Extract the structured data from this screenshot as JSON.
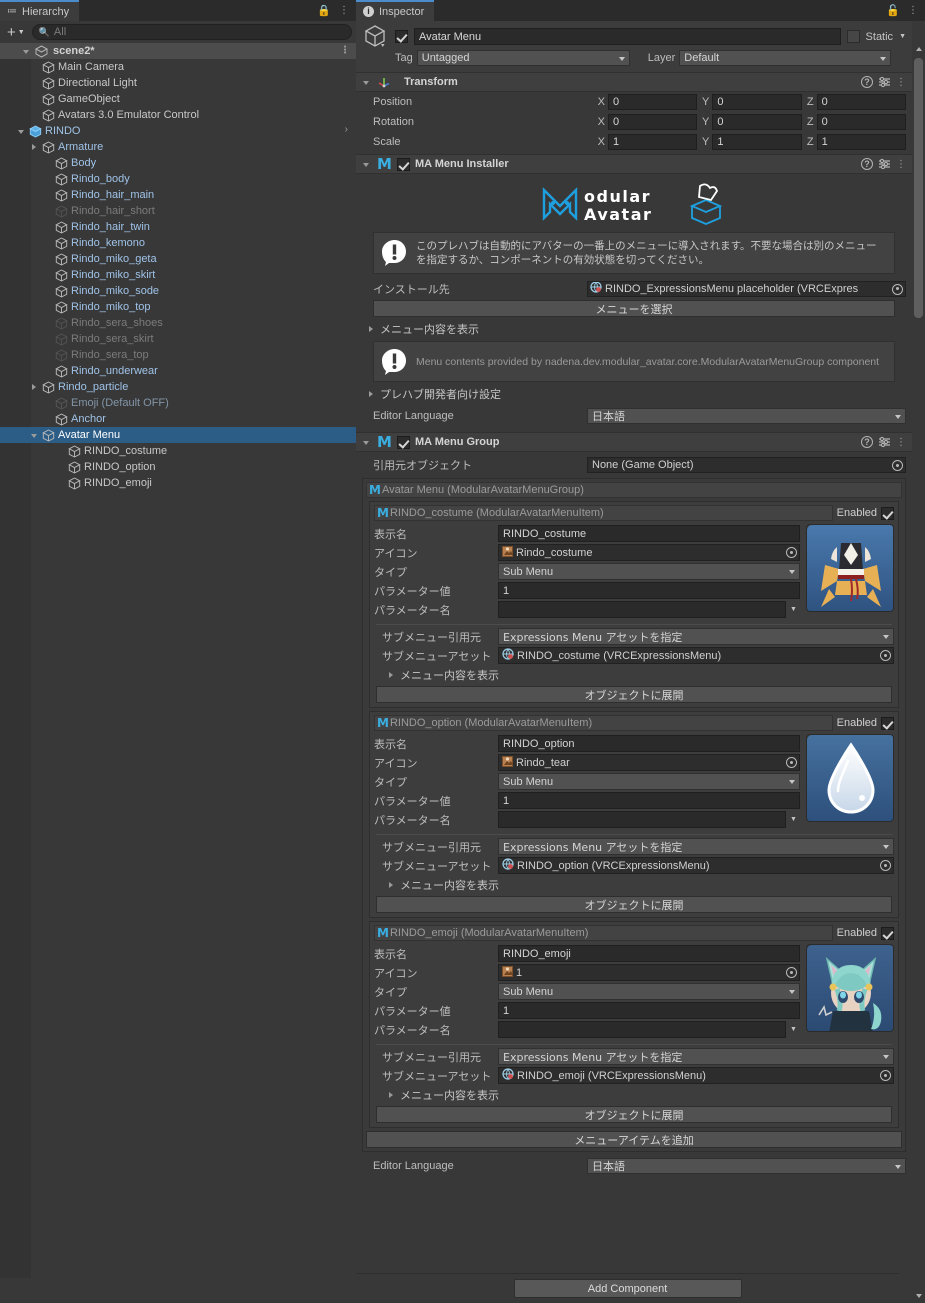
{
  "hierarchy": {
    "tab_label": "Hierarchy",
    "tab_icon": "list-icon",
    "lock_icon": "lock-icon",
    "menu_icon": "kebab-menu-icon",
    "create_label": "+",
    "search_placeholder": "All",
    "scene_name": "scene2*",
    "items": [
      {
        "label": "Main Camera",
        "indent": 2,
        "arrow": "none",
        "style": "white"
      },
      {
        "label": "Directional Light",
        "indent": 2,
        "arrow": "none",
        "style": "white"
      },
      {
        "label": "GameObject",
        "indent": 2,
        "arrow": "none",
        "style": "white"
      },
      {
        "label": "Avatars 3.0 Emulator Control",
        "indent": 2,
        "arrow": "none",
        "style": "white"
      },
      {
        "label": "RINDO",
        "indent": 1,
        "arrow": "down",
        "style": "prefab",
        "chevron_right": true
      },
      {
        "label": "Armature",
        "indent": 2,
        "arrow": "right",
        "style": "prefab"
      },
      {
        "label": "Body",
        "indent": 3,
        "arrow": "none",
        "style": "prefab"
      },
      {
        "label": "Rindo_body",
        "indent": 3,
        "arrow": "none",
        "style": "prefab"
      },
      {
        "label": "Rindo_hair_main",
        "indent": 3,
        "arrow": "none",
        "style": "prefab"
      },
      {
        "label": "Rindo_hair_short",
        "indent": 3,
        "arrow": "none",
        "style": "disabled"
      },
      {
        "label": "Rindo_hair_twin",
        "indent": 3,
        "arrow": "none",
        "style": "prefab"
      },
      {
        "label": "Rindo_kemono",
        "indent": 3,
        "arrow": "none",
        "style": "prefab"
      },
      {
        "label": "Rindo_miko_geta",
        "indent": 3,
        "arrow": "none",
        "style": "prefab"
      },
      {
        "label": "Rindo_miko_skirt",
        "indent": 3,
        "arrow": "none",
        "style": "prefab"
      },
      {
        "label": "Rindo_miko_sode",
        "indent": 3,
        "arrow": "none",
        "style": "prefab"
      },
      {
        "label": "Rindo_miko_top",
        "indent": 3,
        "arrow": "none",
        "style": "prefab"
      },
      {
        "label": "Rindo_sera_shoes",
        "indent": 3,
        "arrow": "none",
        "style": "disabled"
      },
      {
        "label": "Rindo_sera_skirt",
        "indent": 3,
        "arrow": "none",
        "style": "disabled"
      },
      {
        "label": "Rindo_sera_top",
        "indent": 3,
        "arrow": "none",
        "style": "disabled"
      },
      {
        "label": "Rindo_underwear",
        "indent": 3,
        "arrow": "none",
        "style": "prefab"
      },
      {
        "label": "Rindo_particle",
        "indent": 2,
        "arrow": "right",
        "style": "prefab"
      },
      {
        "label": "Emoji (Default OFF)",
        "indent": 3,
        "arrow": "none",
        "style": "disabled2"
      },
      {
        "label": "Anchor",
        "indent": 3,
        "arrow": "none",
        "style": "prefab"
      },
      {
        "label": "Avatar Menu",
        "indent": 2,
        "arrow": "down",
        "style": "selected"
      },
      {
        "label": "RINDO_costume",
        "indent": 4,
        "arrow": "none",
        "style": "white"
      },
      {
        "label": "RINDO_option",
        "indent": 4,
        "arrow": "none",
        "style": "white"
      },
      {
        "label": "RINDO_emoji",
        "indent": 4,
        "arrow": "none",
        "style": "white"
      }
    ]
  },
  "inspector": {
    "tab_label": "Inspector",
    "tab_icon": "info-icon",
    "lock_icon": "lock-icon",
    "menu_icon": "kebab-menu-icon",
    "game_object": {
      "icon": "gameobject-cube-icon",
      "enabled": true,
      "name": "Avatar Menu",
      "static_label": "Static",
      "static_checked": false,
      "tag_label": "Tag",
      "tag_value": "Untagged",
      "layer_label": "Layer",
      "layer_value": "Default"
    },
    "transform": {
      "title": "Transform",
      "icon": "transform-axis-icon",
      "help_icon": "help-icon",
      "preset_icon": "preset-icon",
      "menu_icon": "kebab-menu-icon",
      "rows": [
        {
          "label": "Position",
          "x": "0",
          "y": "0",
          "z": "0"
        },
        {
          "label": "Rotation",
          "x": "0",
          "y": "0",
          "z": "0"
        },
        {
          "label": "Scale",
          "x": "1",
          "y": "1",
          "z": "1"
        }
      ],
      "axis_labels": [
        "X",
        "Y",
        "Z"
      ]
    },
    "menu_installer": {
      "title": "MA Menu Installer",
      "enabled": true,
      "logo_line1": "odular",
      "logo_line2": "Avatar",
      "help_text": "このプレハブは自動的にアバターの一番上のメニューに導入されます。不要な場合は別のメニューを指定するか、コンポーネントの有効状態を切ってください。",
      "install_target_label": "インストール先",
      "install_target_value": "RINDO_ExpressionsMenu placeholder (VRCExpres",
      "select_menu_button": "メニューを選択",
      "show_contents_foldout": "メニュー内容を表示",
      "contents_note": "Menu contents provided by nadena.dev.modular_avatar.core.ModularAvatarMenuGroup component",
      "prefab_dev_foldout": "プレハブ開発者向け設定",
      "editor_language_label": "Editor Language",
      "editor_language_value": "日本語"
    },
    "menu_group": {
      "title": "MA Menu Group",
      "enabled": true,
      "source_object_label": "引用元オブジェクト",
      "source_object_value": "None (Game Object)",
      "group_header": "Avatar Menu (ModularAvatarMenuGroup)",
      "enabled_label": "Enabled",
      "field_labels": {
        "display_name": "表示名",
        "icon": "アイコン",
        "type": "タイプ",
        "param_value": "パラメーター値",
        "param_name": "パラメーター名",
        "submenu_source": "サブメニュー引用元",
        "submenu_asset": "サブメニューアセット",
        "show_contents": "メニュー内容を表示",
        "extract_button": "オブジェクトに展開"
      },
      "items": [
        {
          "header": "RINDO_costume (ModularAvatarMenuItem)",
          "enabled": true,
          "display_name": "RINDO_costume",
          "icon_value": "Rindo_costume",
          "type_value": "Sub Menu",
          "param_value": "1",
          "param_name": "",
          "submenu_source_value": "Expressions Menu アセットを指定",
          "submenu_asset_value": "RINDO_costume (VRCExpressionsMenu)",
          "thumbnail": "costume-thumbnail"
        },
        {
          "header": "RINDO_option (ModularAvatarMenuItem)",
          "enabled": true,
          "display_name": "RINDO_option",
          "icon_value": "Rindo_tear",
          "type_value": "Sub Menu",
          "param_value": "1",
          "param_name": "",
          "submenu_source_value": "Expressions Menu アセットを指定",
          "submenu_asset_value": "RINDO_option (VRCExpressionsMenu)",
          "thumbnail": "teardrop-thumbnail"
        },
        {
          "header": "RINDO_emoji (ModularAvatarMenuItem)",
          "enabled": true,
          "display_name": "RINDO_emoji",
          "icon_value": "1",
          "type_value": "Sub Menu",
          "param_value": "1",
          "param_name": "",
          "submenu_source_value": "Expressions Menu アセットを指定",
          "submenu_asset_value": "RINDO_emoji (VRCExpressionsMenu)",
          "thumbnail": "avatar-portrait-thumbnail"
        }
      ],
      "add_menu_item_button": "メニューアイテムを追加",
      "editor_language_label": "Editor Language",
      "editor_language_value": "日本語"
    },
    "add_component_button": "Add Component"
  },
  "colors": {
    "panel_bg": "#383838",
    "header_bg": "#3f3f3f",
    "selection": "#2c5d87",
    "accent": "#3aaee0",
    "prefab_text": "#9fc3e8",
    "tab_accent": "#4a8ccc"
  }
}
